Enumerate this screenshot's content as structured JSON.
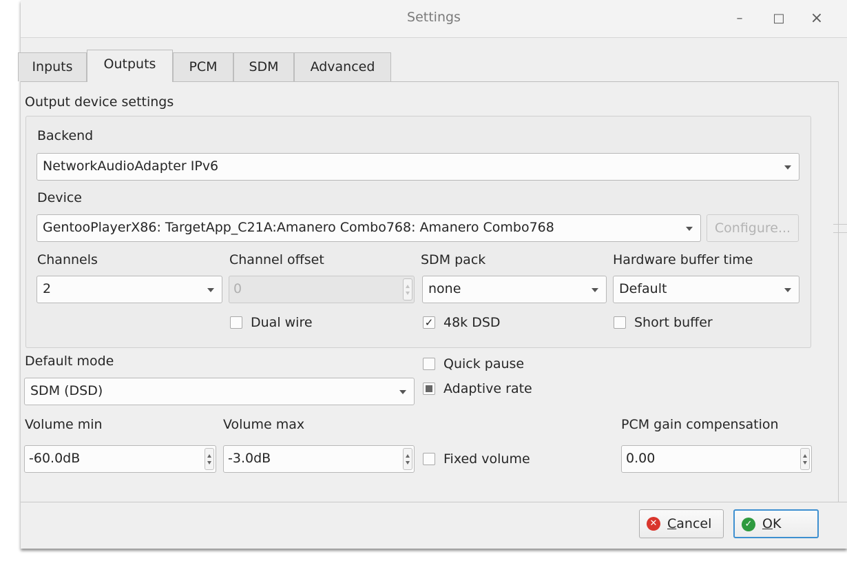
{
  "window": {
    "title": "Settings",
    "minimize_glyph": "–",
    "maximize_glyph": "□",
    "close_glyph": "×"
  },
  "tabs": [
    {
      "label": "Inputs",
      "active": false
    },
    {
      "label": "Outputs",
      "active": true
    },
    {
      "label": "PCM",
      "active": false
    },
    {
      "label": "SDM",
      "active": false
    },
    {
      "label": "Advanced",
      "active": false
    }
  ],
  "outputs": {
    "section_title": "Output device settings",
    "backend": {
      "label": "Backend",
      "value": "NetworkAudioAdapter IPv6"
    },
    "device": {
      "label": "Device",
      "value": "GentooPlayerX86: TargetApp_C21A:Amanero Combo768: Amanero Combo768",
      "configure_label": "Configure..."
    },
    "channels": {
      "label": "Channels",
      "value": "2"
    },
    "channel_offset": {
      "label": "Channel offset",
      "value": "0"
    },
    "sdm_pack": {
      "label": "SDM pack",
      "value": "none"
    },
    "hw_buffer_time": {
      "label": "Hardware buffer time",
      "value": "Default"
    },
    "dual_wire": {
      "label": "Dual wire",
      "checked": false
    },
    "dsd_48k": {
      "label": "48k DSD",
      "checked": true,
      "check_glyph": "✓"
    },
    "short_buffer": {
      "label": "Short buffer",
      "checked": false
    },
    "default_mode": {
      "label": "Default mode",
      "value": "SDM (DSD)"
    },
    "quick_pause": {
      "label": "Quick pause",
      "checked": false
    },
    "adaptive_rate": {
      "label": "Adaptive rate",
      "state": "partial"
    },
    "volume_min": {
      "label": "Volume min",
      "value": "-60.0dB"
    },
    "volume_max": {
      "label": "Volume max",
      "value": "-3.0dB"
    },
    "fixed_volume": {
      "label": "Fixed volume",
      "checked": false
    },
    "pcm_gain": {
      "label": "PCM gain compensation",
      "value": "0.00"
    }
  },
  "buttons": {
    "cancel_mnemonic": "C",
    "cancel_rest": "ancel",
    "ok_mnemonic": "O",
    "ok_rest": "K",
    "cancel_icon_glyph": "✕",
    "ok_icon_glyph": "✓"
  },
  "colors": {
    "accent": "#3d8fd0",
    "cancel_icon": "#d9352c",
    "ok_icon": "#2e9a3f"
  }
}
